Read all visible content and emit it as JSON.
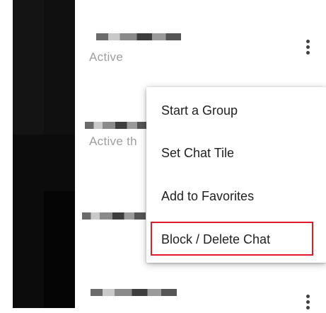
{
  "chat_list": {
    "items": [
      {
        "status": "Active",
        "name_redacted": true
      },
      {
        "status": "Active th",
        "name_redacted": true
      },
      {
        "status": "",
        "name_redacted": true
      },
      {
        "status": "",
        "name_redacted": true
      }
    ]
  },
  "context_menu": {
    "items": [
      {
        "label": "Start a Group"
      },
      {
        "label": "Set Chat Tile"
      },
      {
        "label": "Add to Favorites"
      },
      {
        "label": "Block / Delete Chat"
      }
    ],
    "highlighted_item": "Block / Delete Chat",
    "highlight_color": "#e01b2a"
  },
  "icons": {
    "more": "more-vertical-icon"
  }
}
